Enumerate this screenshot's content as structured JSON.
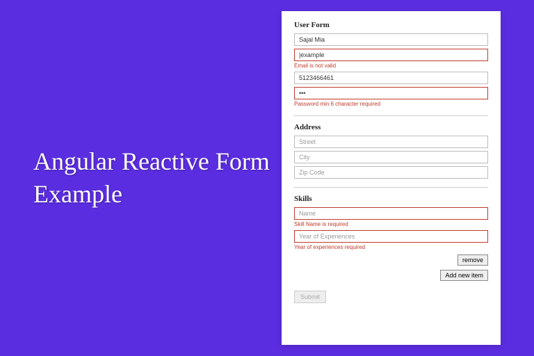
{
  "headline": "Angular Reactive Form Example",
  "form": {
    "userSection": {
      "title": "User Form",
      "name": {
        "value": "Sajal Mia"
      },
      "email": {
        "value": "|example",
        "error": "Email is not valid"
      },
      "phone": {
        "value": "5123466461"
      },
      "password": {
        "value": "•••",
        "error": "Password min 6 character required"
      }
    },
    "addressSection": {
      "title": "Address",
      "street": {
        "placeholder": "Street"
      },
      "city": {
        "placeholder": "City"
      },
      "zip": {
        "placeholder": "Zip Code"
      }
    },
    "skillsSection": {
      "title": "Skills",
      "name": {
        "placeholder": "Name",
        "error": "Skill Name is required"
      },
      "years": {
        "placeholder": "Year of Experiences",
        "error": "Year of experiences required"
      },
      "removeLabel": "remove",
      "addLabel": "Add new item"
    },
    "submitLabel": "Submit"
  }
}
